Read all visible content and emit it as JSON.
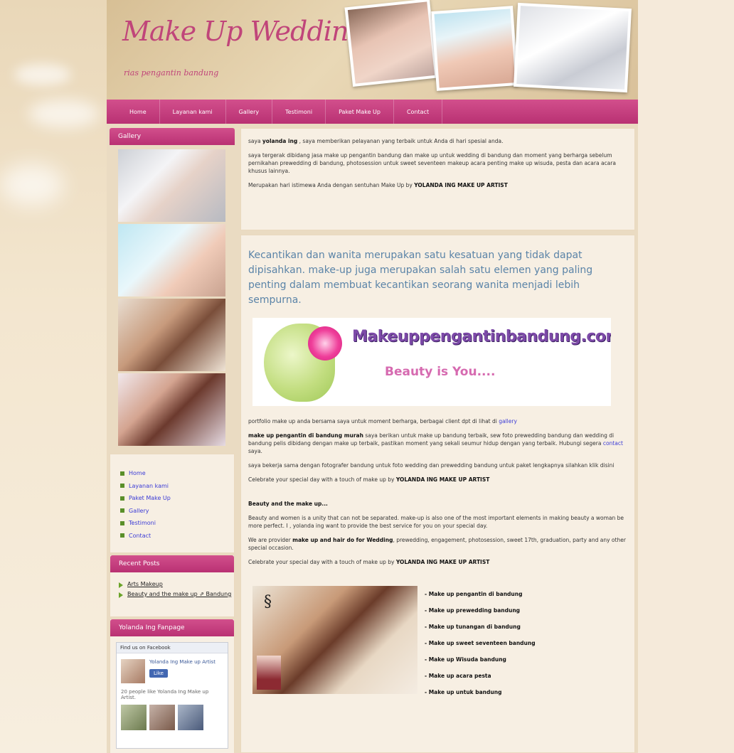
{
  "header": {
    "title": "Make Up Wedding Bandung",
    "tagline": "rias pengantin bandung"
  },
  "nav": [
    "Home",
    "Layanan kami",
    "Gallery",
    "Testimoni",
    "Paket Make Up",
    "Contact"
  ],
  "sidebar": {
    "gallery_title": "Gallery",
    "links": [
      "Home",
      "Layanan kami",
      "Paket Make Up",
      "Gallery",
      "Testimoni",
      "Contact"
    ],
    "recent_title": "Recent Posts",
    "recent": [
      "Arts Makeup",
      "Beauty and the make up ⇗ Bandung"
    ],
    "fb_title": "Yolanda Ing Fanpage",
    "fb_head": "Find us on Facebook",
    "fb_name": "Yolanda Ing Make up Artist",
    "fb_like": "Like",
    "fb_count": "20 people like Yolanda Ing Make up Artist."
  },
  "main": {
    "p1_pre": "saya ",
    "p1_bold": "yolanda ing",
    "p1_post": " , saya memberikan pelayanan yang terbaik untuk Anda di hari spesial anda.",
    "p2": "saya tergerak dibidang jasa make up pengantin bandung dan make up untuk wedding di bandung dan moment yang berharga sebelum pernikahan prewedding di bandung, photosession untuk sweet seventeen makeup acara penting make up wisuda, pesta dan acara acara khusus lainnya.",
    "p3_pre": "Merupakan hari istimewa Anda dengan sentuhan Make Up by ",
    "p3_bold": "YOLANDA ING MAKE UP ARTIST",
    "lead": "Kecantikan dan wanita merupakan satu kesatuan yang tidak dapat dipisahkan. make-up juga merupakan salah satu elemen yang paling penting dalam membuat kecantikan seorang wanita menjadi lebih sempurna.",
    "banner_domain": "Makeuppengantinbandung.com",
    "banner_slogan": "Beauty is You....",
    "p4_pre": "portfolio make up anda bersama saya untuk moment berharga, berbagai client dpt di lihat di ",
    "p4_link": "gallery",
    "p5_pre": "make up pengantin di bandung murah",
    "p5_mid": " saya berikan untuk make up bandung terbaik, sew foto prewedding bandung dan wedding di bandung pelis dibidang dengan make up terbaik, pastikan moment yang sekali seumur hidup dengan yang terbaik. Hubungi segera ",
    "p5_link": "contact",
    "p5_post": " saya.",
    "p6": "saya bekerja sama dengan fotografer bandung untuk foto wedding dan prewedding bandung untuk paket lengkapnya silahkan klik disini",
    "p7_pre": "Celebrate your special day with a touch of make up by ",
    "p7_bold": "YOLANDA ING MAKE UP ARTIST",
    "h_beauty": "Beauty and the make up...",
    "p8": "Beauty and women is a unity that can not be separated. make-up is also one of the most important elements in making beauty a woman be more perfect. I , yolanda ing want to provide the best service for you on your special day.",
    "p9_pre": "We are provider ",
    "p9_bold": "make up and hair do for Wedding",
    "p9_post": ", prewedding, engagement, photosession, sweet 17th, graduation, party and any other special occasion.",
    "p10_pre": "Celebrate your special day with a touch of make up by ",
    "p10_bold": "YOLANDA ING MAKE UP ARTIST",
    "services": [
      "- Make up pengantin di bandung",
      "- Make up prewedding bandung",
      "- Make up tunangan di bandung",
      "- Make up sweet seventeen bandung",
      "- Make up Wisuda bandung",
      "- Make up acara pesta",
      "- Make up untuk bandung"
    ]
  },
  "colors": {
    "accent": "#c0457a",
    "nav": "#b93173",
    "link": "#3b3bd6"
  }
}
